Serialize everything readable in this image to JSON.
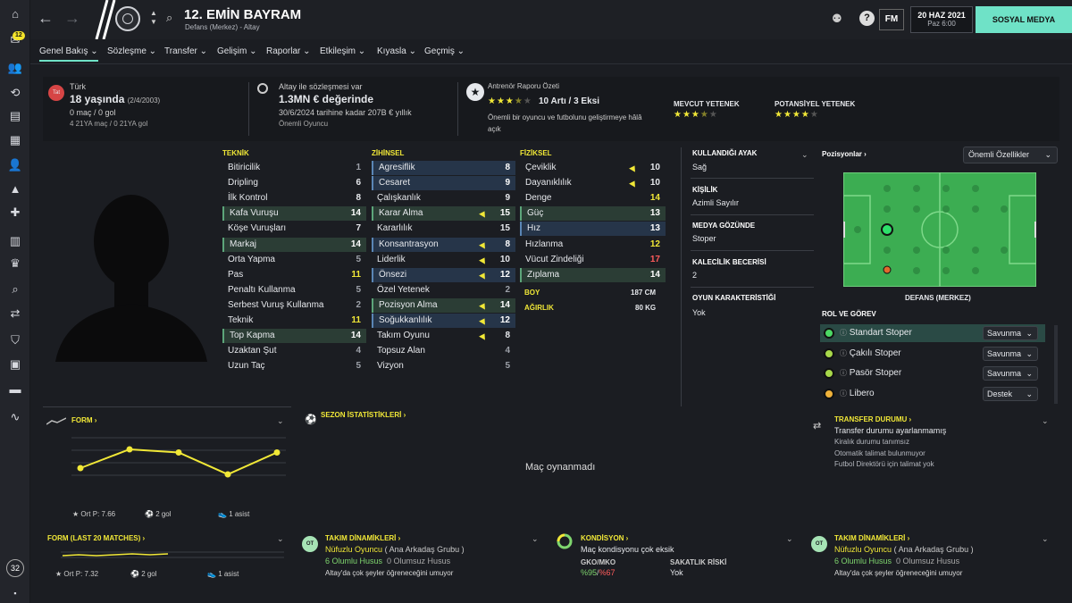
{
  "topbar": {
    "player_name": "12. EMİN BAYRAM",
    "player_sub": "Defans (Merkez) - Altay",
    "fm": "FM",
    "date": "20 HAZ 2021",
    "time": "Paz 6:00",
    "social": "SOSYAL MEDYA"
  },
  "sidebar": {
    "badge": "12",
    "age": "32"
  },
  "tabs": [
    "Genel Bakış",
    "Sözleşme",
    "Transfer",
    "Gelişim",
    "Raporlar",
    "Etkileşim",
    "Kıyasla",
    "Geçmiş"
  ],
  "info": {
    "nation_code": "Tat",
    "nation": "Türk",
    "age_main": "18 yaşında",
    "dob": "(2/4/2003)",
    "apps": "0 maç / 0 gol",
    "u21": "4 21YA maç / 0 21YA gol",
    "contract_line": "Altay ile sözleşmesi var",
    "value": "1.3MN € değerinde",
    "contract_until": "30/6/2024 tarihine kadar 207B € yıllık",
    "status": "Önemli Oyuncu",
    "report_title": "Antrenör Raporu Özeti",
    "report_summary": "10 Artı / 3 Eksi",
    "report_text_1": "Önemli bir oyuncu ve futbolunu geliştirmeye hâlâ",
    "report_text_2": "açık",
    "current_ability_label": "MEVCUT YETENEK",
    "potential_ability_label": "POTANSİYEL YETENEK",
    "report_stars": 3.5,
    "current_stars": 3.5,
    "potential_stars": 4
  },
  "technical": {
    "header": "TEKNİK",
    "rows": [
      {
        "name": "Bitiricilik",
        "value": "1",
        "hl": ""
      },
      {
        "name": "Dripling",
        "value": "6",
        "hl": ""
      },
      {
        "name": "İlk Kontrol",
        "value": "8",
        "hl": ""
      },
      {
        "name": "Kafa Vuruşu",
        "value": "14",
        "hl": "green"
      },
      {
        "name": "Köşe Vuruşları",
        "value": "7",
        "hl": ""
      },
      {
        "name": "Markaj",
        "value": "14",
        "hl": "green"
      },
      {
        "name": "Orta Yapma",
        "value": "5",
        "hl": ""
      },
      {
        "name": "Pas",
        "value": "11",
        "hl": ""
      },
      {
        "name": "Penaltı Kullanma",
        "value": "5",
        "hl": ""
      },
      {
        "name": "Serbest Vuruş Kullanma",
        "value": "2",
        "hl": ""
      },
      {
        "name": "Teknik",
        "value": "11",
        "hl": ""
      },
      {
        "name": "Top Kapma",
        "value": "14",
        "hl": "green"
      },
      {
        "name": "Uzaktan Şut",
        "value": "4",
        "hl": ""
      },
      {
        "name": "Uzun Taç",
        "value": "5",
        "hl": ""
      }
    ]
  },
  "mental": {
    "header": "ZİHİNSEL",
    "rows": [
      {
        "name": "Agresiflik",
        "value": "8",
        "hl": "blue",
        "arrow": false
      },
      {
        "name": "Cesaret",
        "value": "9",
        "hl": "blue",
        "arrow": false
      },
      {
        "name": "Çalışkanlık",
        "value": "9",
        "hl": "",
        "arrow": false
      },
      {
        "name": "Karar Alma",
        "value": "15",
        "hl": "green",
        "arrow": true
      },
      {
        "name": "Kararlılık",
        "value": "15",
        "hl": "",
        "arrow": false
      },
      {
        "name": "Konsantrasyon",
        "value": "8",
        "hl": "blue",
        "arrow": true
      },
      {
        "name": "Liderlik",
        "value": "10",
        "hl": "",
        "arrow": true
      },
      {
        "name": "Önsezi",
        "value": "12",
        "hl": "blue",
        "arrow": true
      },
      {
        "name": "Özel Yetenek",
        "value": "2",
        "hl": "",
        "arrow": false
      },
      {
        "name": "Pozisyon Alma",
        "value": "14",
        "hl": "green",
        "arrow": true
      },
      {
        "name": "Soğukkanlılık",
        "value": "12",
        "hl": "blue",
        "arrow": true
      },
      {
        "name": "Takım Oyunu",
        "value": "8",
        "hl": "",
        "arrow": true
      },
      {
        "name": "Topsuz Alan",
        "value": "4",
        "hl": "",
        "arrow": false
      },
      {
        "name": "Vizyon",
        "value": "5",
        "hl": "",
        "arrow": false
      }
    ]
  },
  "physical": {
    "header": "FİZİKSEL",
    "rows": [
      {
        "name": "Çeviklik",
        "value": "10",
        "hl": "",
        "arrow": true,
        "color": ""
      },
      {
        "name": "Dayanıklılık",
        "value": "10",
        "hl": "",
        "arrow": true,
        "color": ""
      },
      {
        "name": "Denge",
        "value": "14",
        "hl": "",
        "arrow": false,
        "color": "yellow"
      },
      {
        "name": "Güç",
        "value": "13",
        "hl": "green",
        "arrow": false,
        "color": ""
      },
      {
        "name": "Hız",
        "value": "13",
        "hl": "blue",
        "arrow": false,
        "color": ""
      },
      {
        "name": "Hızlanma",
        "value": "12",
        "hl": "",
        "arrow": false,
        "color": "yellow"
      },
      {
        "name": "Vücut Zindeliği",
        "value": "17",
        "hl": "",
        "arrow": false,
        "color": "red"
      },
      {
        "name": "Zıplama",
        "value": "14",
        "hl": "green",
        "arrow": false,
        "color": ""
      }
    ],
    "height_label": "BOY",
    "height": "187 CM",
    "weight_label": "AĞIRLIK",
    "weight": "80 KG"
  },
  "details": {
    "foot_label": "KULLANDIĞI AYAK",
    "foot": "Sağ",
    "personality_label": "KİŞİLİK",
    "personality": "Azimli Sayılır",
    "media_label": "MEDYA GÖZÜNDE",
    "media": "Stoper",
    "gk_label": "KALECİLİK BECERİSİ",
    "gk": "2",
    "style_label": "OYUN KARAKTERİSTİĞİ",
    "style": "Yok"
  },
  "positions": {
    "label": "Pozisyonlar",
    "dropdown": "Önemli Özellikler",
    "position_name": "DEFANS (MERKEZ)"
  },
  "roles": {
    "label": "ROL VE GÖREV",
    "rows": [
      {
        "name": "Standart Stoper",
        "duty": "Savunma",
        "color": "#4cd964"
      },
      {
        "name": "Çakılı Stoper",
        "duty": "Savunma",
        "color": "#a8d84a"
      },
      {
        "name": "Pasör Stoper",
        "duty": "Savunma",
        "color": "#a8d84a"
      },
      {
        "name": "Libero",
        "duty": "Destek",
        "color": "#f0b23a"
      }
    ]
  },
  "form": {
    "label": "FORM",
    "rating": "Ort P: 7.66",
    "goals": "2 gol",
    "assists": "1 asist",
    "points": [
      7.3,
      7.9,
      7.8,
      7.1,
      7.8
    ]
  },
  "form20": {
    "label": "FORM (LAST 20 MATCHES)",
    "rating": "Ort P: 7.32",
    "goals": "2 gol",
    "assists": "1 asist"
  },
  "season": {
    "label": "SEZON İSTATİSTİKLERİ",
    "empty": "Maç oynanmadı"
  },
  "transfer": {
    "label": "TRANSFER DURUMU",
    "status": "Transfer durumu ayarlanmamış",
    "loan": "Kiralık durumu tanımsız",
    "auto": "Otomatik talimat bulunmuyor",
    "dof": "Futbol Direktörü için talimat yok"
  },
  "dynamics": {
    "label": "TAKIM DİNAMİKLERİ",
    "badge": "OT",
    "role": "Nüfuzlu Oyuncu",
    "group": "( Ana Arkadaş Grubu )",
    "pos": "6 Olumlu Husus",
    "neg": "0 Olumsuz Husus",
    "text": "Altay'da çok şeyler öğreneceğini umuyor"
  },
  "condition": {
    "label": "KONDİSYON",
    "status": "Maç kondisyonu çok eksik",
    "gko_label": "GKO/MKO",
    "gko_a": "%95",
    "gko_b": "%67",
    "injury_label": "SAKATLIK RİSKİ",
    "injury": "Yok"
  }
}
